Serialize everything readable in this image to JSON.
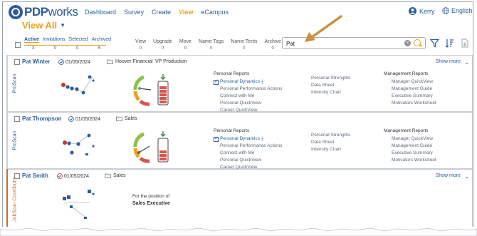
{
  "nav": {
    "logo_bold": "PDP",
    "logo_thin": "works",
    "links": [
      "Dashboard",
      "Survey",
      "Create",
      "View",
      "eCampus"
    ],
    "active": "View",
    "user": "Kerry",
    "language": "English"
  },
  "page": {
    "title": "View All",
    "filters": [
      "Active",
      "Invitations",
      "Selected",
      "Archived"
    ],
    "filter_counts": [
      "3",
      "0",
      "0",
      "6"
    ],
    "actions": [
      {
        "label": "View",
        "count": "0"
      },
      {
        "label": "Upgrade",
        "count": "0"
      },
      {
        "label": "Move",
        "count": "0"
      },
      {
        "label": "Name Tags",
        "count": "0"
      },
      {
        "label": "Name Tents",
        "count": "0"
      },
      {
        "label": "Archive",
        "count": "0"
      }
    ],
    "search_value": "Pat"
  },
  "cards": [
    {
      "type": "ProScan",
      "name": "Pat Winter",
      "date": "01/05/2024",
      "company": "Hoover Financial",
      "role": "VP Production",
      "show_more": "Show more",
      "personal_header": "Personal Reports",
      "personal": [
        "Personal Dynamics",
        "Personal Performance Actions",
        "Connect with Me",
        "Personal QuickView",
        "Career QuickView"
      ],
      "personal_mid": [
        "Personal Strengths",
        "Data Sheet",
        "Intensity Chart"
      ],
      "mgmt_header": "Management Reports",
      "mgmt": [
        "Manager QuickView",
        "Management Guide",
        "Executive Summary",
        "Motivators Worksheet"
      ]
    },
    {
      "type": "ProScan",
      "name": "Pat Thompson",
      "date": "01/05/2024",
      "company": "Sales",
      "role": "",
      "show_more": "",
      "personal_header": "Personal Reports",
      "personal": [
        "Personal Dynamics",
        "Personal Performance Actions",
        "Connect with Me",
        "Personal QuickView",
        "Career QuickView"
      ],
      "personal_mid": [
        "Personal Strengths",
        "Data Sheet",
        "Intensity Chart"
      ],
      "mgmt_header": "Management Reports",
      "mgmt": [
        "Manager QuickView",
        "Management Guide",
        "Executive Summary",
        "Motivators Worksheet"
      ]
    },
    {
      "type": "JobScan Contributor",
      "name": "Pat Smith",
      "date": "01/05/2024",
      "company": "Sales",
      "show_more": "Show more",
      "position_label": "For the position of",
      "position": "Sales Executive"
    }
  ],
  "colors": {
    "brand": "#2b5d9c",
    "accent": "#e8a21c",
    "jobscan": "#c96a2c"
  }
}
